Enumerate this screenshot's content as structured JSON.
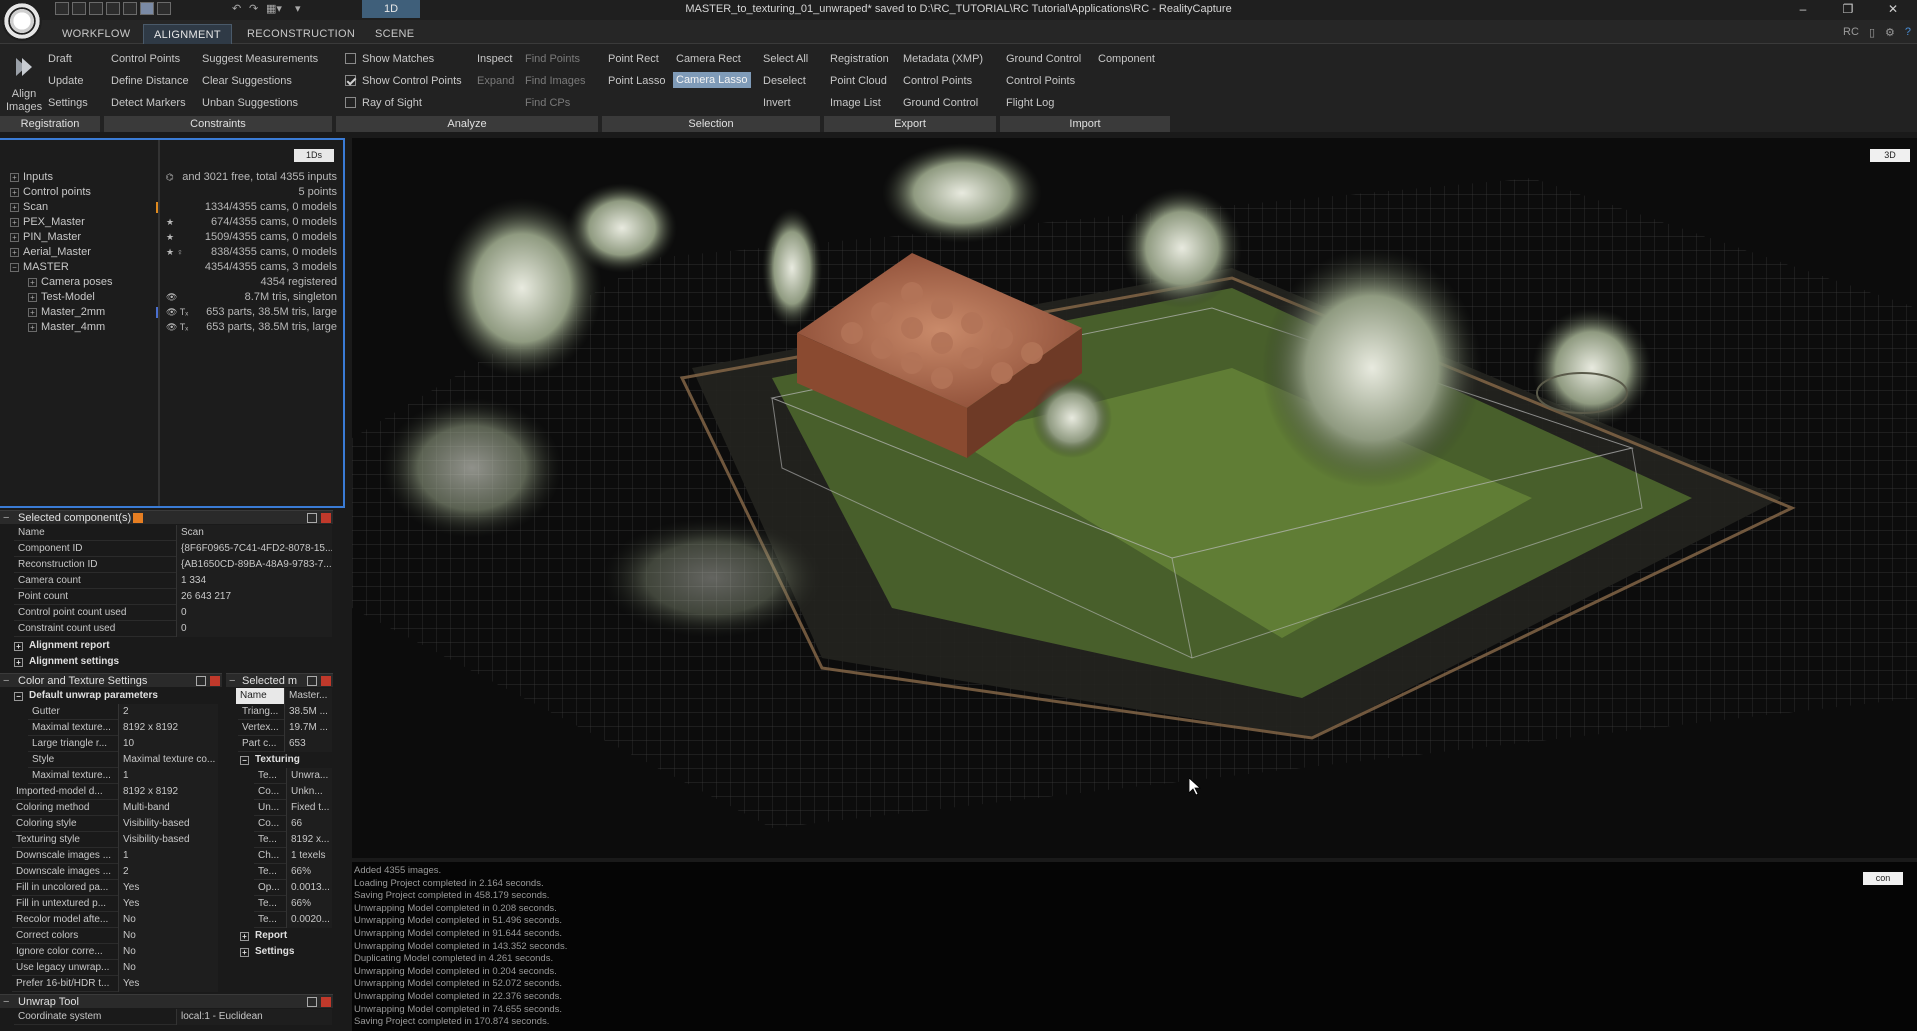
{
  "window": {
    "title": "MASTER_to_texturing_01_unwraped* saved to D:\\RC_TUTORIAL\\RC Tutorial\\Applications\\RC - RealityCapture",
    "layout_tab": "1D",
    "minimize": "–",
    "restore": "❐",
    "close": "✕"
  },
  "tabs": [
    "WORKFLOW",
    "ALIGNMENT",
    "RECONSTRUCTION",
    "SCENE"
  ],
  "active_tab": "ALIGNMENT",
  "top_right": {
    "rc": "RC"
  },
  "ribbon": {
    "align_images": "Align Images",
    "registration": [
      "Draft",
      "Update",
      "Settings"
    ],
    "constraints_col1": [
      "Control Points",
      "Define Distance",
      "Detect Markers"
    ],
    "constraints_col2": [
      "Suggest Measurements",
      "Clear Suggestions",
      "Unban Suggestions"
    ],
    "analyze_checks": [
      "Show Matches",
      "Show Control Points",
      "Ray of Sight"
    ],
    "analyze_checks_state": [
      false,
      true,
      false
    ],
    "analyze_col2": [
      "Inspect",
      "Expand"
    ],
    "analyze_col3": [
      "Find Points",
      "Find Images",
      "Find CPs"
    ],
    "selection_col1": [
      "Point Rect",
      "Point Lasso"
    ],
    "selection_col2": [
      "Camera Rect",
      "Camera Lasso"
    ],
    "selection_col3": [
      "Select All",
      "Deselect",
      "Invert"
    ],
    "export_col1": [
      "Registration",
      "Point Cloud",
      "Image List"
    ],
    "export_col2": [
      "Metadata (XMP)",
      "Control Points",
      "Ground Control"
    ],
    "import_col1": [
      "Ground Control",
      "Control Points",
      "Flight Log"
    ],
    "import_col2": [
      "Component"
    ],
    "groups": [
      "Registration",
      "Constraints",
      "Analyze",
      "Selection",
      "Export",
      "Import"
    ]
  },
  "tree": {
    "button": "1Ds",
    "rows": [
      {
        "name": "Inputs",
        "info": "and 3021 free, total 4355 inputs",
        "icon": "⌬",
        "mark": ""
      },
      {
        "name": "Control points",
        "info": "5 points",
        "icon": "",
        "mark": ""
      },
      {
        "name": "Scan",
        "info": "1334/4355 cams, 0 models",
        "icon": "",
        "mark": "#e08a1e"
      },
      {
        "name": "PEX_Master",
        "info": "674/4355 cams, 0 models",
        "icon": "★",
        "mark": ""
      },
      {
        "name": "PIN_Master",
        "info": "1509/4355 cams, 0 models",
        "icon": "★",
        "mark": ""
      },
      {
        "name": "Aerial_Master",
        "info": "838/4355 cams, 0 models",
        "icon": "★ ♀",
        "mark": ""
      },
      {
        "name": "MASTER",
        "info": "4354/4355 cams, 3 models",
        "icon": "",
        "mark": ""
      },
      {
        "name": "Camera poses",
        "info": "4354 registered",
        "icon": "",
        "mark": ""
      },
      {
        "name": "Test-Model",
        "info": "8.7M tris, singleton",
        "icon": "👁",
        "mark": ""
      },
      {
        "name": "Master_2mm",
        "info": "653 parts, 38.5M tris, large",
        "icon": "👁 Tₓ",
        "mark": "#4a6fd0"
      },
      {
        "name": "Master_4mm",
        "info": "653 parts, 38.5M tris, large",
        "icon": "👁 Tₓ",
        "mark": ""
      }
    ]
  },
  "selected_component": {
    "title": "Selected component(s)",
    "props": [
      {
        "k": "Name",
        "v": "Scan"
      },
      {
        "k": "Component ID",
        "v": "{8F6F0965-7C41-4FD2-8078-15..."
      },
      {
        "k": "Reconstruction ID",
        "v": "{AB1650CD-89BA-48A9-9783-7..."
      },
      {
        "k": "Camera count",
        "v": "1 334"
      },
      {
        "k": "Point count",
        "v": "26 643 217"
      },
      {
        "k": "Control point count used",
        "v": "0"
      },
      {
        "k": "Constraint count used",
        "v": "0"
      }
    ],
    "sections": [
      "Alignment report",
      "Alignment settings"
    ]
  },
  "color_texture": {
    "title": "Color and Texture Settings",
    "section": "Default unwrap parameters",
    "sub_props": [
      {
        "k": "Gutter",
        "v": "2"
      },
      {
        "k": "Maximal texture...",
        "v": "8192 x 8192"
      },
      {
        "k": "Large triangle r...",
        "v": "10"
      },
      {
        "k": "Style",
        "v": "Maximal texture co..."
      },
      {
        "k": "Maximal texture...",
        "v": "1"
      }
    ],
    "props": [
      {
        "k": "Imported-model d...",
        "v": "8192 x 8192"
      },
      {
        "k": "Coloring method",
        "v": "Multi-band"
      },
      {
        "k": "Coloring style",
        "v": "Visibility-based"
      },
      {
        "k": "Texturing style",
        "v": "Visibility-based"
      },
      {
        "k": "Downscale images ...",
        "v": "1"
      },
      {
        "k": "Downscale images ...",
        "v": "2"
      },
      {
        "k": "Fill in uncolored pa...",
        "v": "Yes"
      },
      {
        "k": "Fill in untextured p...",
        "v": "Yes"
      },
      {
        "k": "Recolor model afte...",
        "v": "No"
      },
      {
        "k": "Correct colors",
        "v": "No"
      },
      {
        "k": "Ignore color corre...",
        "v": "No"
      },
      {
        "k": "Use legacy unwrap...",
        "v": "No"
      },
      {
        "k": "Prefer 16-bit/HDR t...",
        "v": "Yes"
      }
    ]
  },
  "selected_model": {
    "title": "Selected m",
    "header": {
      "k": "Name",
      "v": "Master..."
    },
    "props": [
      {
        "k": "Triang...",
        "v": "38.5M ..."
      },
      {
        "k": "Vertex...",
        "v": "19.7M ..."
      },
      {
        "k": "Part c...",
        "v": "653"
      }
    ],
    "section": "Texturing",
    "tex_props": [
      {
        "k": "Te...",
        "v": "Unwra..."
      },
      {
        "k": "Co...",
        "v": "Unkn..."
      },
      {
        "k": "Un...",
        "v": "Fixed t..."
      },
      {
        "k": "Co...",
        "v": "66"
      },
      {
        "k": "Te...",
        "v": "8192 x..."
      },
      {
        "k": "Ch...",
        "v": "1 texels"
      },
      {
        "k": "Te...",
        "v": "66%"
      },
      {
        "k": "Op...",
        "v": "0.0013..."
      },
      {
        "k": "Te...",
        "v": "66%"
      },
      {
        "k": "Te...",
        "v": "0.0020..."
      }
    ],
    "sections": [
      "Report",
      "Settings"
    ]
  },
  "unwrap_tool": {
    "title": "Unwrap Tool",
    "props": [
      {
        "k": "Coordinate system",
        "v": "local:1 - Euclidean"
      }
    ]
  },
  "viewport": {
    "button": "3D"
  },
  "console": {
    "button": "con",
    "lines": [
      "Added 4355 images.",
      "Loading Project completed in 2.164 seconds.",
      "Saving Project completed in 458.179 seconds.",
      "Unwrapping Model completed in 0.208 seconds.",
      "Unwrapping Model completed in 51.496 seconds.",
      "Unwrapping Model completed in 91.644 seconds.",
      "Unwrapping Model completed in 143.352 seconds.",
      "Duplicating Model completed in 4.261 seconds.",
      "Unwrapping Model completed in 0.204 seconds.",
      "Unwrapping Model completed in 52.072 seconds.",
      "Unwrapping Model completed in 22.376 seconds.",
      "Unwrapping Model completed in 74.655 seconds.",
      "Saving Project completed in 170.874 seconds."
    ]
  }
}
